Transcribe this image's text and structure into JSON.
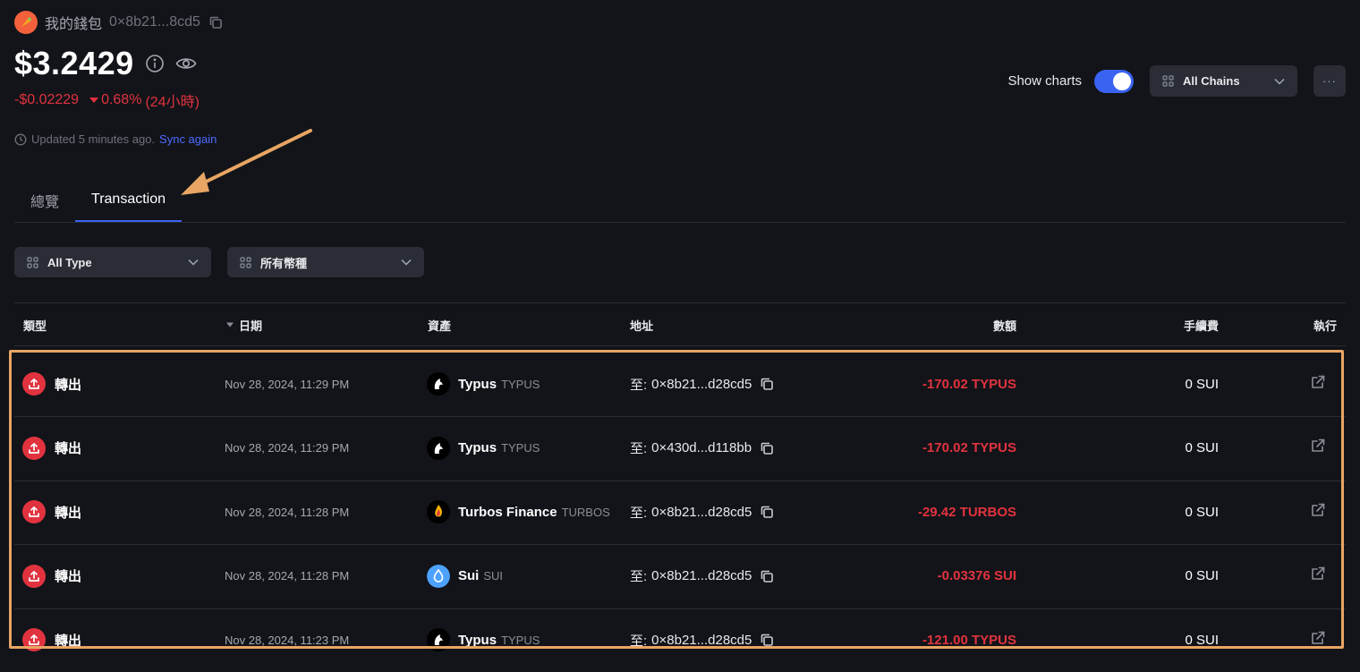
{
  "wallet": {
    "name": "我的錢包",
    "address": "0×8b21...8cd5",
    "balance": "$3.2429",
    "change_amount": "-$0.02229",
    "change_pct": "0.68%",
    "change_period": "(24小時)",
    "updated_text": "Updated 5 minutes ago.",
    "sync_label": "Sync again"
  },
  "controls": {
    "show_charts_label": "Show charts",
    "show_charts_on": true,
    "chain_select": "All Chains",
    "more_label": "···"
  },
  "tabs": [
    {
      "label": "總覽",
      "active": false
    },
    {
      "label": "Transaction",
      "active": true
    }
  ],
  "filters": {
    "type": "All Type",
    "currency": "所有幣種"
  },
  "table": {
    "headers": {
      "type": "類型",
      "date": "日期",
      "asset": "資產",
      "address": "地址",
      "amount": "數額",
      "fee": "手續費",
      "action": "執行"
    },
    "rows": [
      {
        "type": "轉出",
        "date": "Nov 28, 2024, 11:29 PM",
        "asset_name": "Typus",
        "asset_symbol": "TYPUS",
        "asset_icon": "typus-logo",
        "addr_prefix": "至:",
        "address": "0×8b21...d28cd5",
        "amount": "-170.02 TYPUS",
        "fee": "0 SUI"
      },
      {
        "type": "轉出",
        "date": "Nov 28, 2024, 11:29 PM",
        "asset_name": "Typus",
        "asset_symbol": "TYPUS",
        "asset_icon": "typus-logo",
        "addr_prefix": "至:",
        "address": "0×430d...d118bb",
        "amount": "-170.02 TYPUS",
        "fee": "0 SUI"
      },
      {
        "type": "轉出",
        "date": "Nov 28, 2024, 11:28 PM",
        "asset_name": "Turbos Finance",
        "asset_symbol": "TURBOS",
        "asset_icon": "turbos-logo",
        "addr_prefix": "至:",
        "address": "0×8b21...d28cd5",
        "amount": "-29.42 TURBOS",
        "fee": "0 SUI"
      },
      {
        "type": "轉出",
        "date": "Nov 28, 2024, 11:28 PM",
        "asset_name": "Sui",
        "asset_symbol": "SUI",
        "asset_icon": "sui-logo",
        "addr_prefix": "至:",
        "address": "0×8b21...d28cd5",
        "amount": "-0.03376 SUI",
        "fee": "0 SUI"
      },
      {
        "type": "轉出",
        "date": "Nov 28, 2024, 11:23 PM",
        "asset_name": "Typus",
        "asset_symbol": "TYPUS",
        "asset_icon": "typus-logo",
        "addr_prefix": "至:",
        "address": "0×8b21...d28cd5",
        "amount": "-121.00 TYPUS",
        "fee": "0 SUI"
      }
    ]
  },
  "colors": {
    "background": "#121419",
    "accent": "#3a63f2",
    "negative": "#e1333f",
    "annotation": "#e8a563"
  }
}
